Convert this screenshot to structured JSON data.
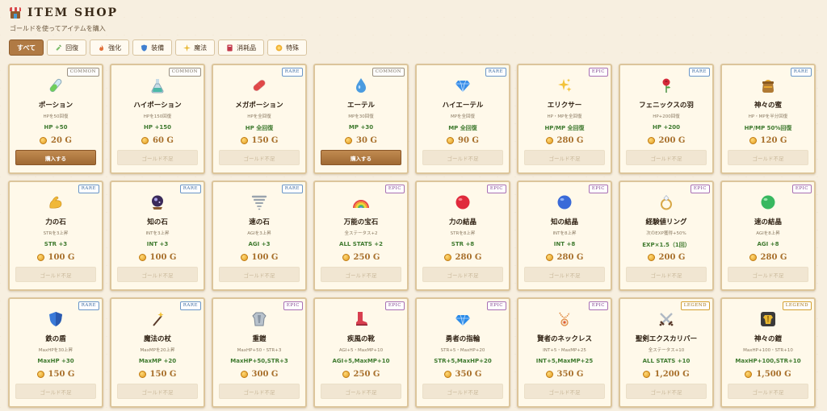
{
  "header": {
    "title": "ITEM SHOP",
    "subtitle": "ゴールドを使ってアイテムを購入"
  },
  "tabs": [
    {
      "label": "すべて",
      "icon": "none",
      "active": true
    },
    {
      "label": "回復",
      "icon": "syringe-icon",
      "color": "#7bbf6a"
    },
    {
      "label": "強化",
      "icon": "flame-icon",
      "color": "#e0703a"
    },
    {
      "label": "装備",
      "icon": "shield-icon",
      "color": "#3f7fd0"
    },
    {
      "label": "魔法",
      "icon": "sparkle-icon",
      "color": "#e8b730"
    },
    {
      "label": "消耗品",
      "icon": "book-icon",
      "color": "#c2384a"
    },
    {
      "label": "特殊",
      "icon": "star-icon",
      "color": "#f0b030"
    }
  ],
  "buy_label": "購入する",
  "disabled_label": "ゴールド不足",
  "currency": "G",
  "items": [
    {
      "name": "ポーション",
      "rarity": "COMMON",
      "desc": "HPを50回復",
      "stat": "HP +50",
      "price": "20",
      "affordable": true,
      "icon": "test-tube-icon"
    },
    {
      "name": "ハイポーション",
      "rarity": "COMMON",
      "desc": "HPを150回復",
      "stat": "HP +150",
      "price": "60",
      "affordable": false,
      "icon": "flask-icon"
    },
    {
      "name": "メガポーション",
      "rarity": "RARE",
      "desc": "HPを全回復",
      "stat": "HP 全回復",
      "price": "150",
      "affordable": false,
      "icon": "pill-icon"
    },
    {
      "name": "エーテル",
      "rarity": "COMMON",
      "desc": "MPを30回復",
      "stat": "MP +30",
      "price": "30",
      "affordable": true,
      "icon": "droplet-icon"
    },
    {
      "name": "ハイエーテル",
      "rarity": "RARE",
      "desc": "MPを全回復",
      "stat": "MP 全回復",
      "price": "90",
      "affordable": false,
      "icon": "diamond-icon"
    },
    {
      "name": "エリクサー",
      "rarity": "EPIC",
      "desc": "HP・MPを全回復",
      "stat": "HP/MP 全回復",
      "price": "280",
      "affordable": false,
      "icon": "sparkles-icon"
    },
    {
      "name": "フェニックスの羽",
      "rarity": "RARE",
      "desc": "HP+200回復",
      "stat": "HP +200",
      "price": "200",
      "affordable": false,
      "icon": "rose-icon"
    },
    {
      "name": "神々の蜜",
      "rarity": "RARE",
      "desc": "HP・MPを半分回復",
      "stat": "HP/MP 50%回復",
      "price": "120",
      "affordable": false,
      "icon": "honey-pot-icon"
    },
    {
      "name": "力の石",
      "rarity": "RARE",
      "desc": "STRを3上昇",
      "stat": "STR +3",
      "price": "100",
      "affordable": false,
      "icon": "muscle-icon"
    },
    {
      "name": "知の石",
      "rarity": "RARE",
      "desc": "INTを3上昇",
      "stat": "INT +3",
      "price": "100",
      "affordable": false,
      "icon": "crystal-ball-icon"
    },
    {
      "name": "速の石",
      "rarity": "RARE",
      "desc": "AGIを3上昇",
      "stat": "AGI +3",
      "price": "100",
      "affordable": false,
      "icon": "tornado-icon"
    },
    {
      "name": "万能の宝石",
      "rarity": "EPIC",
      "desc": "全ステータス+2",
      "stat": "ALL STATS +2",
      "price": "250",
      "affordable": false,
      "icon": "rainbow-icon"
    },
    {
      "name": "力の結晶",
      "rarity": "EPIC",
      "desc": "STRを8上昇",
      "stat": "STR +8",
      "price": "280",
      "affordable": false,
      "icon": "red-orb-icon"
    },
    {
      "name": "知の結晶",
      "rarity": "EPIC",
      "desc": "INTを8上昇",
      "stat": "INT +8",
      "price": "280",
      "affordable": false,
      "icon": "blue-orb-icon"
    },
    {
      "name": "経験値リング",
      "rarity": "EPIC",
      "desc": "次のEXP獲得+50%",
      "stat": "EXP×1.5（1回）",
      "price": "200",
      "affordable": false,
      "icon": "ring-icon"
    },
    {
      "name": "速の結晶",
      "rarity": "EPIC",
      "desc": "AGIを8上昇",
      "stat": "AGI +8",
      "price": "280",
      "affordable": false,
      "icon": "green-orb-icon"
    },
    {
      "name": "鉄の盾",
      "rarity": "RARE",
      "desc": "MaxHPを30上昇",
      "stat": "MaxHP +30",
      "price": "150",
      "affordable": false,
      "icon": "shield-icon"
    },
    {
      "name": "魔法の杖",
      "rarity": "RARE",
      "desc": "MaxMPを20上昇",
      "stat": "MaxMP +20",
      "price": "150",
      "affordable": false,
      "icon": "magic-wand-icon"
    },
    {
      "name": "重鎧",
      "rarity": "EPIC",
      "desc": "MaxHP+50・STR+3",
      "stat": "MaxHP+50,STR+3",
      "price": "300",
      "affordable": false,
      "icon": "armor-icon"
    },
    {
      "name": "疾風の靴",
      "rarity": "EPIC",
      "desc": "AGI+5・MaxMP+10",
      "stat": "AGI+5,MaxMP+10",
      "price": "250",
      "affordable": false,
      "icon": "boot-icon"
    },
    {
      "name": "勇者の指輪",
      "rarity": "EPIC",
      "desc": "STR+5・MaxHP+20",
      "stat": "STR+5,MaxHP+20",
      "price": "350",
      "affordable": false,
      "icon": "gem-ring-icon"
    },
    {
      "name": "賢者のネックレス",
      "rarity": "EPIC",
      "desc": "INT+5・MaxMP+25",
      "stat": "INT+5,MaxMP+25",
      "price": "350",
      "affordable": false,
      "icon": "necklace-icon"
    },
    {
      "name": "聖剣エクスカリバー",
      "rarity": "LEGEND",
      "desc": "全ステータス+10",
      "stat": "ALL STATS +10",
      "price": "1,200",
      "affordable": false,
      "icon": "crossed-swords-icon"
    },
    {
      "name": "神々の鎧",
      "rarity": "LEGEND",
      "desc": "MaxHP+100・STR+10",
      "stat": "MaxHP+100,STR+10",
      "price": "1,500",
      "affordable": false,
      "icon": "divine-armor-icon"
    }
  ]
}
